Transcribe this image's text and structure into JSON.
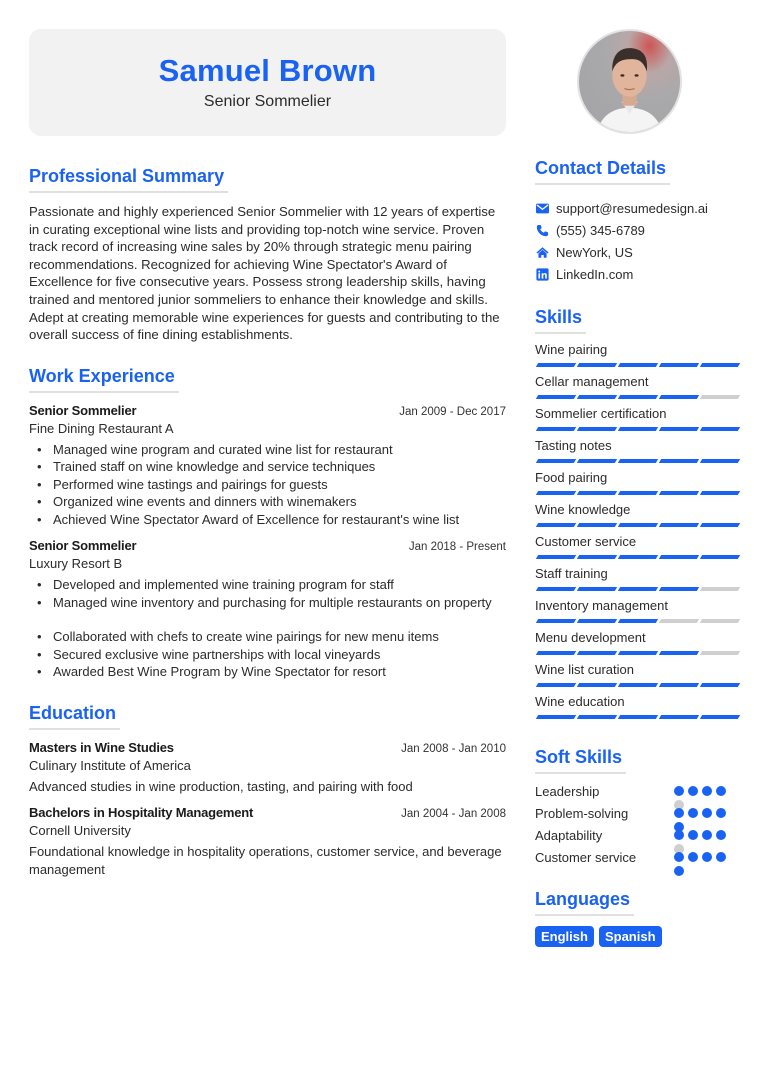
{
  "header": {
    "name": "Samuel Brown",
    "title": "Senior Sommelier"
  },
  "photo": {
    "alt": "profile-photo"
  },
  "summary": {
    "heading": "Professional Summary",
    "text": "Passionate and highly experienced Senior Sommelier with 12 years of expertise in curating exceptional wine lists and providing top-notch wine service. Proven track record of increasing wine sales by 20% through strategic menu pairing recommendations. Recognized for achieving Wine Spectator's Award of Excellence for five consecutive years. Possess strong leadership skills, having trained and mentored junior sommeliers to enhance their knowledge and skills. Adept at creating memorable wine experiences for guests and contributing to the overall success of fine dining establishments."
  },
  "experience": {
    "heading": "Work Experience",
    "jobs": [
      {
        "role": "Senior Sommelier",
        "dates": "Jan 2009 - Dec 2017",
        "company": "Fine Dining Restaurant A",
        "bullets": [
          "Managed wine program and curated wine list for restaurant",
          "Trained staff on wine knowledge and service techniques",
          "Performed wine tastings and pairings for guests",
          "Organized wine events and dinners with winemakers",
          "Achieved Wine Spectator Award of Excellence for restaurant's wine list"
        ]
      },
      {
        "role": "Senior Sommelier",
        "dates": "Jan 2018 - Present",
        "company": "Luxury Resort B",
        "bullets": [
          "Developed and implemented wine training program for staff",
          "Managed wine inventory and purchasing for multiple restaurants on property"
        ],
        "bullets2": [
          "Collaborated with chefs to create wine pairings for new menu items",
          "Secured exclusive wine partnerships with local vineyards",
          "Awarded Best Wine Program by Wine Spectator for resort"
        ]
      }
    ]
  },
  "education": {
    "heading": "Education",
    "items": [
      {
        "degree": "Masters in Wine Studies",
        "dates": "Jan 2008 - Jan 2010",
        "school": "Culinary Institute of America",
        "desc": "Advanced studies in wine production, tasting, and pairing with food"
      },
      {
        "degree": "Bachelors in Hospitality Management",
        "dates": "Jan 2004 - Jan 2008",
        "school": "Cornell University",
        "desc": "Foundational knowledge in hospitality operations, customer service, and beverage management"
      }
    ]
  },
  "contact": {
    "heading": "Contact Details",
    "items": [
      {
        "icon": "envelope-icon",
        "text": "support@resumedesign.ai"
      },
      {
        "icon": "phone-icon",
        "text": "(555) 345-6789"
      },
      {
        "icon": "home-icon",
        "text": "NewYork, US"
      },
      {
        "icon": "linkedin-icon",
        "text": "LinkedIn.com"
      }
    ]
  },
  "skills": {
    "heading": "Skills",
    "max": 5,
    "items": [
      {
        "name": "Wine pairing",
        "level": 5
      },
      {
        "name": "Cellar management",
        "level": 4
      },
      {
        "name": "Sommelier certification",
        "level": 5
      },
      {
        "name": "Tasting notes",
        "level": 5
      },
      {
        "name": "Food pairing",
        "level": 5
      },
      {
        "name": "Wine knowledge",
        "level": 5
      },
      {
        "name": "Customer service",
        "level": 5
      },
      {
        "name": "Staff training",
        "level": 4
      },
      {
        "name": "Inventory management",
        "level": 3
      },
      {
        "name": "Menu development",
        "level": 4
      },
      {
        "name": "Wine list curation",
        "level": 5
      },
      {
        "name": "Wine education",
        "level": 5
      }
    ]
  },
  "soft_skills": {
    "heading": "Soft Skills",
    "max": 5,
    "items": [
      {
        "name": "Leadership",
        "level": 4
      },
      {
        "name": "Problem-solving",
        "level": 5
      },
      {
        "name": "Adaptability",
        "level": 4
      },
      {
        "name": "Customer service",
        "level": 5
      }
    ]
  },
  "languages": {
    "heading": "Languages",
    "items": [
      "English",
      "Spanish"
    ]
  },
  "colors": {
    "accent": "#1a62f2",
    "inactive": "#cfcfcf",
    "header_bg": "#f2f2f3"
  }
}
